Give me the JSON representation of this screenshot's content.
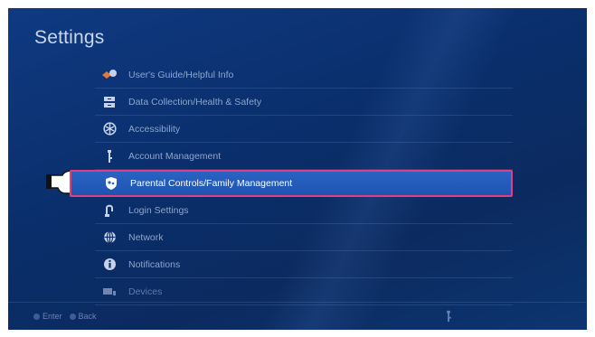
{
  "title": "Settings",
  "menu": {
    "items": [
      {
        "label": "User's Guide/Helpful Info",
        "icon": "users-guide-icon"
      },
      {
        "label": "Data Collection/Health & Safety",
        "icon": "data-collection-icon"
      },
      {
        "label": "Accessibility",
        "icon": "accessibility-icon"
      },
      {
        "label": "Account Management",
        "icon": "account-management-icon"
      },
      {
        "label": "Parental Controls/Family Management",
        "icon": "parental-controls-icon",
        "selected": true
      },
      {
        "label": "Login Settings",
        "icon": "login-settings-icon"
      },
      {
        "label": "Network",
        "icon": "network-icon"
      },
      {
        "label": "Notifications",
        "icon": "notifications-icon"
      },
      {
        "label": "Devices",
        "icon": "devices-icon"
      }
    ]
  },
  "footer": {
    "enter_label": "Enter",
    "back_label": "Back"
  },
  "colors": {
    "background": "#0b2f6c",
    "highlight": "#2a63c4",
    "highlight_border": "#e0407f"
  }
}
